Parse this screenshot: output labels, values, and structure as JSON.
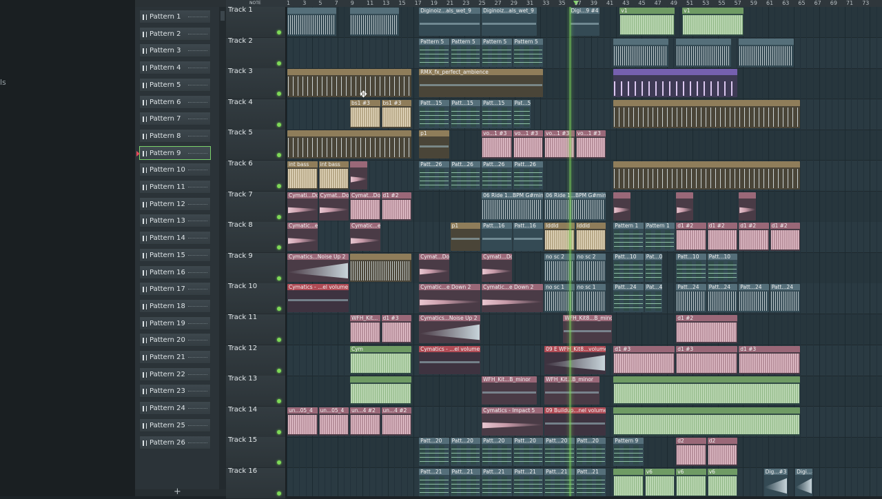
{
  "left_panel": {
    "cut_text": "ls"
  },
  "picker": {
    "add_label": "+",
    "patterns": [
      "Pattern 1",
      "Pattern 2",
      "Pattern 3",
      "Pattern 4",
      "Pattern 5",
      "Pattern 6",
      "Pattern 7",
      "Pattern 8",
      "Pattern 9",
      "Pattern 10",
      "Pattern 11",
      "Pattern 12",
      "Pattern 13",
      "Pattern 14",
      "Pattern 15",
      "Pattern 16",
      "Pattern 17",
      "Pattern 18",
      "Pattern 19",
      "Pattern 20",
      "Pattern 21",
      "Pattern 22",
      "Pattern 23",
      "Pattern 24",
      "Pattern 25",
      "Pattern 26"
    ],
    "selected": "Pattern 9"
  },
  "ruler": {
    "note_label": "NOTE",
    "bars": [
      "1",
      "3",
      "5",
      "7",
      "9",
      "11",
      "13",
      "15",
      "17",
      "19",
      "21",
      "23",
      "25",
      "27",
      "29",
      "31",
      "33",
      "35",
      "37",
      "39",
      "41",
      "43",
      "45",
      "47",
      "49",
      "51",
      "53",
      "55",
      "57",
      "59",
      "61",
      "63",
      "65",
      "67",
      "69",
      "71",
      "73"
    ]
  },
  "tracks": [
    "Track 1",
    "Track 2",
    "Track 3",
    "Track 4",
    "Track 5",
    "Track 6",
    "Track 7",
    "Track 8",
    "Track 9",
    "Track 10",
    "Track 11",
    "Track 12",
    "Track 13",
    "Track 14",
    "Track 15",
    "Track 16"
  ],
  "clips": [
    {
      "t": 0,
      "s": 0,
      "w": 8,
      "c": "gray",
      "n": "",
      "wv": "white"
    },
    {
      "t": 0,
      "s": 10,
      "w": 8,
      "c": "gray",
      "n": "",
      "wv": "white"
    },
    {
      "t": 0,
      "s": 21,
      "w": 10,
      "c": "gray",
      "n": "Diginoiz...als_wet_9",
      "wv": "thin"
    },
    {
      "t": 0,
      "s": 31,
      "w": 9,
      "c": "gray",
      "n": "Diginoiz...als_wet_9",
      "wv": "thin"
    },
    {
      "t": 0,
      "s": 45,
      "w": 5,
      "c": "gray",
      "n": "Digi...9 #4",
      "wv": "thin"
    },
    {
      "t": 0,
      "s": 53,
      "w": 9,
      "c": "green",
      "n": "v1",
      "wv": "green"
    },
    {
      "t": 0,
      "s": 63,
      "w": 10,
      "c": "green",
      "n": "v1",
      "wv": "green"
    },
    {
      "t": 1,
      "s": 21,
      "w": 5,
      "c": "gray",
      "n": "Pattern 5",
      "wv": "notes"
    },
    {
      "t": 1,
      "s": 26,
      "w": 5,
      "c": "gray",
      "n": "Pattern 5",
      "wv": "notes"
    },
    {
      "t": 1,
      "s": 31,
      "w": 5,
      "c": "gray",
      "n": "Pattern 5",
      "wv": "notes"
    },
    {
      "t": 1,
      "s": 36,
      "w": 5,
      "c": "gray",
      "n": "Pattern 5",
      "wv": "notes"
    },
    {
      "t": 1,
      "s": 52,
      "w": 9,
      "c": "gray",
      "n": "",
      "wv": "white"
    },
    {
      "t": 1,
      "s": 62,
      "w": 9,
      "c": "gray",
      "n": "",
      "wv": "white"
    },
    {
      "t": 1,
      "s": 72,
      "w": 9,
      "c": "gray",
      "n": "",
      "wv": "white"
    },
    {
      "t": 2,
      "s": 0,
      "w": 20,
      "c": "tan",
      "n": "",
      "wv": "spikes"
    },
    {
      "t": 2,
      "s": 21,
      "w": 20,
      "c": "tan",
      "n": "RMX_fx_perfect_ambience",
      "wv": "thin"
    },
    {
      "t": 2,
      "s": 52,
      "w": 20,
      "c": "violet",
      "n": "",
      "wv": "saw"
    },
    {
      "t": 3,
      "s": 10,
      "w": 5,
      "c": "tan",
      "n": "bs1 #3",
      "wv": "tan"
    },
    {
      "t": 3,
      "s": 15,
      "w": 5,
      "c": "tan",
      "n": "bs1 #3",
      "wv": "tan"
    },
    {
      "t": 3,
      "s": 21,
      "w": 5,
      "c": "gray",
      "n": "Patt...15",
      "wv": "notes"
    },
    {
      "t": 3,
      "s": 26,
      "w": 5,
      "c": "gray",
      "n": "Patt...15",
      "wv": "notes"
    },
    {
      "t": 3,
      "s": 31,
      "w": 5,
      "c": "gray",
      "n": "Patt...15",
      "wv": "notes"
    },
    {
      "t": 3,
      "s": 36,
      "w": 3,
      "c": "gray",
      "n": "Pat...5",
      "wv": "notes"
    },
    {
      "t": 3,
      "s": 52,
      "w": 30,
      "c": "tan",
      "n": "",
      "wv": "spikes"
    },
    {
      "t": 4,
      "s": 0,
      "w": 20,
      "c": "tan",
      "n": "",
      "wv": "spikes"
    },
    {
      "t": 4,
      "s": 21,
      "w": 5,
      "c": "tan",
      "n": "p1",
      "wv": "thin"
    },
    {
      "t": 4,
      "s": 31,
      "w": 5,
      "c": "pink",
      "n": "vo...1 #3",
      "wv": "pink"
    },
    {
      "t": 4,
      "s": 36,
      "w": 5,
      "c": "pink",
      "n": "vo...1 #3",
      "wv": "pink"
    },
    {
      "t": 4,
      "s": 41,
      "w": 5,
      "c": "pink",
      "n": "vo...1 #3",
      "wv": "pink"
    },
    {
      "t": 4,
      "s": 46,
      "w": 5,
      "c": "pink",
      "n": "vo...1 #3",
      "wv": "pink"
    },
    {
      "t": 5,
      "s": 0,
      "w": 5,
      "c": "tan",
      "n": "int bass",
      "wv": "tan"
    },
    {
      "t": 5,
      "s": 5,
      "w": 5,
      "c": "tan",
      "n": "int bass",
      "wv": "tan"
    },
    {
      "t": 5,
      "s": 10,
      "w": 3,
      "c": "pink",
      "n": "",
      "wv": "ramp"
    },
    {
      "t": 5,
      "s": 21,
      "w": 5,
      "c": "gray",
      "n": "Patt...26",
      "wv": "notes"
    },
    {
      "t": 5,
      "s": 26,
      "w": 5,
      "c": "gray",
      "n": "Patt...26",
      "wv": "notes"
    },
    {
      "t": 5,
      "s": 31,
      "w": 5,
      "c": "gray",
      "n": "Patt...26",
      "wv": "notes"
    },
    {
      "t": 5,
      "s": 36,
      "w": 5,
      "c": "gray",
      "n": "Patt...26",
      "wv": "notes"
    },
    {
      "t": 5,
      "s": 52,
      "w": 30,
      "c": "tan",
      "n": "",
      "wv": "spikes"
    },
    {
      "t": 6,
      "s": 0,
      "w": 5,
      "c": "pink",
      "n": "Cymati...Down 1",
      "wv": "ramp"
    },
    {
      "t": 6,
      "s": 5,
      "w": 5,
      "c": "pink",
      "n": "Cymat...Down 1",
      "wv": "ramp"
    },
    {
      "t": 6,
      "s": 10,
      "w": 5,
      "c": "pink",
      "n": "Cymat...Down 1",
      "wv": "pink"
    },
    {
      "t": 6,
      "s": 15,
      "w": 5,
      "c": "pink",
      "n": "d1 #2",
      "wv": "pink"
    },
    {
      "t": 6,
      "s": 31,
      "w": 10,
      "c": "gray",
      "n": "06 Ride 1...BPM G#min",
      "wv": "white"
    },
    {
      "t": 6,
      "s": 41,
      "w": 10,
      "c": "gray",
      "n": "06 Ride 1...BPM G#min",
      "wv": "white"
    },
    {
      "t": 6,
      "s": 52,
      "w": 3,
      "c": "pink",
      "n": "",
      "wv": "ramp"
    },
    {
      "t": 6,
      "s": 62,
      "w": 3,
      "c": "pink",
      "n": "",
      "wv": "ramp"
    },
    {
      "t": 6,
      "s": 72,
      "w": 3,
      "c": "pink",
      "n": "",
      "wv": "ramp"
    },
    {
      "t": 7,
      "s": 0,
      "w": 5,
      "c": "pink",
      "n": "Cymatic...e Down 2",
      "wv": "ramp"
    },
    {
      "t": 7,
      "s": 10,
      "w": 5,
      "c": "pink",
      "n": "Cymatic...e Down 2",
      "wv": "ramp"
    },
    {
      "t": 7,
      "s": 26,
      "w": 5,
      "c": "tan",
      "n": "p1",
      "wv": "thin"
    },
    {
      "t": 7,
      "s": 31,
      "w": 5,
      "c": "gray",
      "n": "Patt...16",
      "wv": "thin"
    },
    {
      "t": 7,
      "s": 36,
      "w": 5,
      "c": "gray",
      "n": "Patt...16",
      "wv": "thin"
    },
    {
      "t": 7,
      "s": 41,
      "w": 5,
      "c": "tan",
      "n": "lddld",
      "wv": "tan"
    },
    {
      "t": 7,
      "s": 46,
      "w": 5,
      "c": "tan",
      "n": "lddld",
      "wv": "tan"
    },
    {
      "t": 7,
      "s": 52,
      "w": 5,
      "c": "gray",
      "n": "Pattern 1",
      "wv": "notes"
    },
    {
      "t": 7,
      "s": 57,
      "w": 5,
      "c": "gray",
      "n": "Pattern 1",
      "wv": "notes"
    },
    {
      "t": 7,
      "s": 62,
      "w": 5,
      "c": "pink",
      "n": "d1 #2",
      "wv": "pink"
    },
    {
      "t": 7,
      "s": 67,
      "w": 5,
      "c": "pink",
      "n": "d1 #2",
      "wv": "pink"
    },
    {
      "t": 7,
      "s": 72,
      "w": 5,
      "c": "pink",
      "n": "d1 #2",
      "wv": "pink"
    },
    {
      "t": 7,
      "s": 77,
      "w": 5,
      "c": "pink",
      "n": "d1 #2",
      "wv": "pink"
    },
    {
      "t": 8,
      "s": 0,
      "w": 10,
      "c": "pink",
      "n": "Cymatics...Noise Up 2",
      "wv": "rampup"
    },
    {
      "t": 8,
      "s": 10,
      "w": 10,
      "c": "tan",
      "n": "",
      "wv": "white"
    },
    {
      "t": 8,
      "s": 21,
      "w": 5,
      "c": "pink",
      "n": "Cymat...Down 1",
      "wv": "ramp"
    },
    {
      "t": 8,
      "s": 31,
      "w": 5,
      "c": "pink",
      "n": "Cymati...Down 1",
      "wv": "ramp"
    },
    {
      "t": 8,
      "s": 41,
      "w": 5,
      "c": "gray",
      "n": "no sc 2",
      "wv": "white"
    },
    {
      "t": 8,
      "s": 46,
      "w": 5,
      "c": "gray",
      "n": "no sc 2",
      "wv": "white"
    },
    {
      "t": 8,
      "s": 52,
      "w": 5,
      "c": "gray",
      "n": "Patt...10",
      "wv": "notes"
    },
    {
      "t": 8,
      "s": 57,
      "w": 3,
      "c": "gray",
      "n": "Pat...0",
      "wv": "notes"
    },
    {
      "t": 8,
      "s": 62,
      "w": 5,
      "c": "gray",
      "n": "Patt...10",
      "wv": "notes"
    },
    {
      "t": 8,
      "s": 67,
      "w": 5,
      "c": "gray",
      "n": "Patt...10",
      "wv": "notes"
    },
    {
      "t": 9,
      "s": 0,
      "w": 10,
      "c": "red",
      "n": "Cymatics - ...el volume",
      "wv": "thin"
    },
    {
      "t": 9,
      "s": 21,
      "w": 10,
      "c": "pink",
      "n": "Cymatic...e Down 2",
      "wv": "ramp"
    },
    {
      "t": 9,
      "s": 31,
      "w": 10,
      "c": "pink",
      "n": "Cymatic...e Down 2",
      "wv": "ramp"
    },
    {
      "t": 9,
      "s": 41,
      "w": 5,
      "c": "gray",
      "n": "no sc 1",
      "wv": "white"
    },
    {
      "t": 9,
      "s": 46,
      "w": 5,
      "c": "gray",
      "n": "no sc 1",
      "wv": "white"
    },
    {
      "t": 9,
      "s": 52,
      "w": 5,
      "c": "gray",
      "n": "Patt...24",
      "wv": "notes"
    },
    {
      "t": 9,
      "s": 57,
      "w": 3,
      "c": "gray",
      "n": "Pat...4",
      "wv": "notes"
    },
    {
      "t": 9,
      "s": 62,
      "w": 5,
      "c": "gray",
      "n": "Patt...24",
      "wv": "white"
    },
    {
      "t": 9,
      "s": 67,
      "w": 5,
      "c": "gray",
      "n": "Patt...24",
      "wv": "white"
    },
    {
      "t": 9,
      "s": 72,
      "w": 5,
      "c": "gray",
      "n": "Patt...24",
      "wv": "white"
    },
    {
      "t": 9,
      "s": 77,
      "w": 5,
      "c": "gray",
      "n": "Patt...24",
      "wv": "white"
    },
    {
      "t": 10,
      "s": 10,
      "w": 5,
      "c": "pink",
      "n": "WFH_Kit...",
      "wv": "pink"
    },
    {
      "t": 10,
      "s": 15,
      "w": 5,
      "c": "pink",
      "n": "d1 #3",
      "wv": "pink"
    },
    {
      "t": 10,
      "s": 21,
      "w": 10,
      "c": "pink",
      "n": "Cymatics...Noise Up 2",
      "wv": "rampup"
    },
    {
      "t": 10,
      "s": 44,
      "w": 8,
      "c": "pink",
      "n": "WFH_Kit8...B_minor",
      "wv": "thin"
    },
    {
      "t": 10,
      "s": 62,
      "w": 10,
      "c": "pink",
      "n": "d1 #2",
      "wv": "pink"
    },
    {
      "t": 11,
      "s": 10,
      "w": 10,
      "c": "green",
      "n": "Cym",
      "wv": "green"
    },
    {
      "t": 11,
      "s": 21,
      "w": 10,
      "c": "red",
      "n": "Cymatics - ...el volume",
      "wv": "thin"
    },
    {
      "t": 11,
      "s": 41,
      "w": 10,
      "c": "red",
      "n": "09 E WFH_Kit8...volume",
      "wv": "rampup"
    },
    {
      "t": 11,
      "s": 52,
      "w": 10,
      "c": "pink",
      "n": "d1 #3",
      "wv": "pink"
    },
    {
      "t": 11,
      "s": 62,
      "w": 10,
      "c": "pink",
      "n": "d1 #3",
      "wv": "pink"
    },
    {
      "t": 11,
      "s": 72,
      "w": 10,
      "c": "pink",
      "n": "d1 #3",
      "wv": "pink"
    },
    {
      "t": 12,
      "s": 10,
      "w": 10,
      "c": "green",
      "n": "",
      "wv": "green"
    },
    {
      "t": 12,
      "s": 31,
      "w": 9,
      "c": "pink",
      "n": "WFH_Kit...B_minor",
      "wv": "thin"
    },
    {
      "t": 12,
      "s": 41,
      "w": 9,
      "c": "pink",
      "n": "WFH_Kit...B_minor",
      "wv": "thin"
    },
    {
      "t": 12,
      "s": 52,
      "w": 30,
      "c": "green",
      "n": "",
      "wv": "green"
    },
    {
      "t": 13,
      "s": 0,
      "w": 5,
      "c": "pink",
      "n": "un...05_4",
      "wv": "pink"
    },
    {
      "t": 13,
      "s": 5,
      "w": 5,
      "c": "pink",
      "n": "un...05_4",
      "wv": "pink"
    },
    {
      "t": 13,
      "s": 10,
      "w": 5,
      "c": "pink",
      "n": "un...4 #2",
      "wv": "pink"
    },
    {
      "t": 13,
      "s": 15,
      "w": 5,
      "c": "pink",
      "n": "un...4 #2",
      "wv": "pink"
    },
    {
      "t": 13,
      "s": 31,
      "w": 10,
      "c": "pink",
      "n": "Cymatics - Impact 5",
      "wv": "ramp"
    },
    {
      "t": 13,
      "s": 41,
      "w": 10,
      "c": "red",
      "n": "09 Buildup...nel volume",
      "wv": "thin"
    },
    {
      "t": 13,
      "s": 52,
      "w": 30,
      "c": "green",
      "n": "",
      "wv": "green"
    },
    {
      "t": 14,
      "s": 21,
      "w": 5,
      "c": "gray",
      "n": "Patt...20",
      "wv": "notes"
    },
    {
      "t": 14,
      "s": 26,
      "w": 5,
      "c": "gray",
      "n": "Patt...20",
      "wv": "notes"
    },
    {
      "t": 14,
      "s": 31,
      "w": 5,
      "c": "gray",
      "n": "Patt...20",
      "wv": "notes"
    },
    {
      "t": 14,
      "s": 36,
      "w": 5,
      "c": "gray",
      "n": "Patt...20",
      "wv": "notes"
    },
    {
      "t": 14,
      "s": 41,
      "w": 5,
      "c": "gray",
      "n": "Patt...20",
      "wv": "notes"
    },
    {
      "t": 14,
      "s": 46,
      "w": 5,
      "c": "gray",
      "n": "Patt...20",
      "wv": "notes"
    },
    {
      "t": 14,
      "s": 52,
      "w": 5,
      "c": "gray",
      "n": "Pattern 9",
      "wv": "notes"
    },
    {
      "t": 14,
      "s": 62,
      "w": 5,
      "c": "pink",
      "n": "d2",
      "wv": "pink"
    },
    {
      "t": 14,
      "s": 67,
      "w": 5,
      "c": "pink",
      "n": "d2",
      "wv": "pink"
    },
    {
      "t": 15,
      "s": 21,
      "w": 5,
      "c": "gray",
      "n": "Patt...21",
      "wv": "notes"
    },
    {
      "t": 15,
      "s": 26,
      "w": 5,
      "c": "gray",
      "n": "Patt...21",
      "wv": "notes"
    },
    {
      "t": 15,
      "s": 31,
      "w": 5,
      "c": "gray",
      "n": "Patt...21",
      "wv": "notes"
    },
    {
      "t": 15,
      "s": 36,
      "w": 5,
      "c": "gray",
      "n": "Patt...21",
      "wv": "notes"
    },
    {
      "t": 15,
      "s": 41,
      "w": 5,
      "c": "gray",
      "n": "Patt...21",
      "wv": "notes"
    },
    {
      "t": 15,
      "s": 46,
      "w": 5,
      "c": "gray",
      "n": "Patt...21",
      "wv": "notes"
    },
    {
      "t": 15,
      "s": 52,
      "w": 5,
      "c": "green",
      "n": "",
      "wv": "green"
    },
    {
      "t": 15,
      "s": 57,
      "w": 5,
      "c": "green",
      "n": "v6",
      "wv": "green"
    },
    {
      "t": 15,
      "s": 62,
      "w": 5,
      "c": "green",
      "n": "v6",
      "wv": "green"
    },
    {
      "t": 15,
      "s": 67,
      "w": 5,
      "c": "green",
      "n": "v6",
      "wv": "green"
    },
    {
      "t": 15,
      "s": 76,
      "w": 4,
      "c": "gray",
      "n": "Dig...#3",
      "wv": "rampup"
    },
    {
      "t": 15,
      "s": 81,
      "w": 3,
      "c": "gray",
      "n": "Digi...#3",
      "wv": "rampup"
    }
  ],
  "colors": {
    "playhead": "#7ed957",
    "selected_pattern_border": "#7bd36b",
    "header_led": "#7ed957"
  }
}
